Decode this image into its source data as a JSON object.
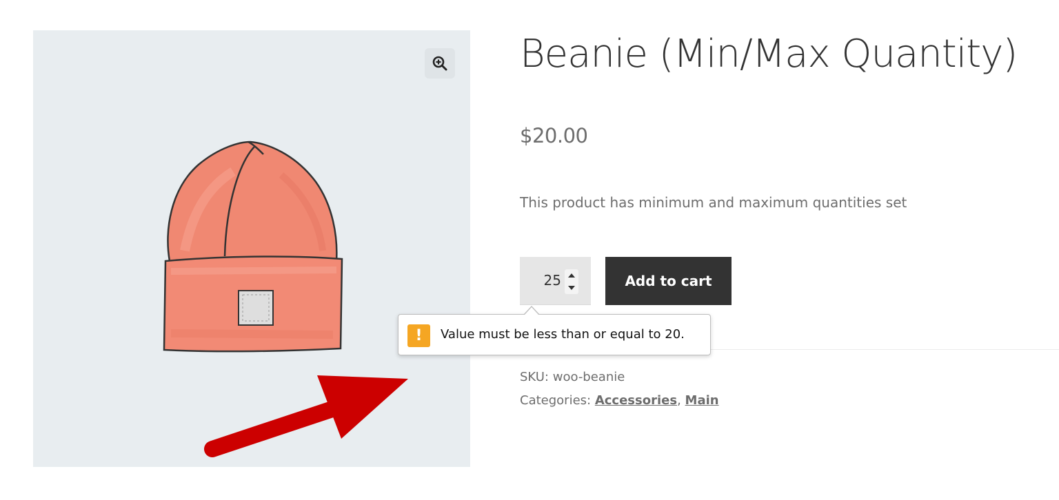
{
  "product": {
    "title": "Beanie (Min/Max Quantity)",
    "price": "$20.00",
    "description": "This product has minimum and maximum quantities set",
    "image_icon": "beanie-hat-illustration"
  },
  "gallery": {
    "zoom_icon": "zoom-in-icon"
  },
  "cart": {
    "quantity_value": "25",
    "add_to_cart_label": "Add to cart"
  },
  "validation": {
    "warning_icon_glyph": "!",
    "message": "Value must be less than or equal to 20."
  },
  "meta": {
    "sku_label": "SKU:",
    "sku_value": "woo-beanie",
    "categories_label": "Categories:",
    "categories": [
      "Accessories",
      "Main"
    ],
    "separator": ","
  },
  "colors": {
    "button_bg": "#333333",
    "warning": "#f5a623",
    "annotation_arrow": "#cc0000",
    "gallery_bg": "#e8edf0"
  }
}
